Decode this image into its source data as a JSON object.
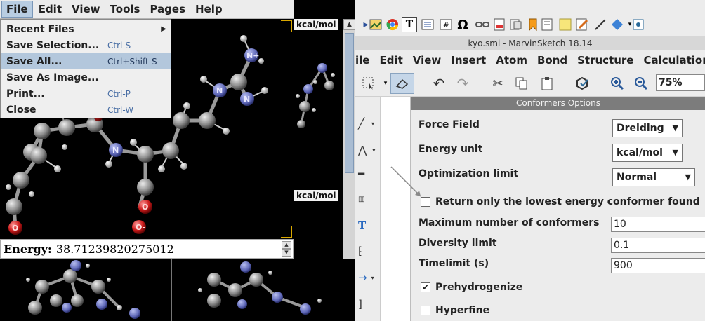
{
  "viewer": {
    "menus": [
      "File",
      "Edit",
      "View",
      "Tools",
      "Pages",
      "Help"
    ],
    "file_menu": {
      "items": [
        {
          "label": "Recent Files",
          "shortcut": ""
        },
        {
          "label": "Save Selection...",
          "shortcut": "Ctrl-S"
        },
        {
          "label": "Save All...",
          "shortcut": "Ctrl+Shift-S"
        },
        {
          "label": "Save As Image...",
          "shortcut": ""
        },
        {
          "label": "Print...",
          "shortcut": "Ctrl-P"
        },
        {
          "label": "Close",
          "shortcut": "Ctrl-W"
        }
      ],
      "submenu_arrow": "▶"
    },
    "unit_label_top": "kcal/mol",
    "unit_label_mid": "kcal/mol",
    "energy": {
      "label": "Energy:",
      "value": "38.71239820275012"
    },
    "scroll_up": "▲",
    "atoms": {
      "n": "N",
      "n_plus": "N+",
      "o": "O",
      "o_minus": "O-"
    }
  },
  "marvin": {
    "title": "kyo.smi - MarvinSketch 18.14",
    "menus": [
      "ile",
      "Edit",
      "View",
      "Insert",
      "Atom",
      "Bond",
      "Structure",
      "Calculations"
    ],
    "zoom": "75%",
    "omega": "Ω",
    "text_tool": "T"
  },
  "dialog": {
    "title": "Conformers Options",
    "force_field": {
      "label": "Force Field",
      "value": "Dreiding"
    },
    "energy_unit": {
      "label": "Energy unit",
      "value": "kcal/mol"
    },
    "optimization_limit": {
      "label": "Optimization limit",
      "value": "Normal"
    },
    "lowest_only": {
      "label": "Return only the lowest energy conformer found",
      "checked": false
    },
    "max_conformers": {
      "label": "Maximum number of conformers",
      "value": "10"
    },
    "diversity_limit": {
      "label": "Diversity limit",
      "value": "0.1"
    },
    "timelimit": {
      "label": "Timelimit (s)",
      "value": "900"
    },
    "prehydrogenize": {
      "label": "Prehydrogenize",
      "checked": true,
      "mark": "✔"
    },
    "hyperfine": {
      "label": "Hyperfine",
      "checked": false
    }
  },
  "colors": {
    "highlight": "#b3c7dc",
    "dialog_title_bg": "#7c7c7c",
    "nitrogen": "#6b74c8",
    "oxygen": "#d22020",
    "carbon": "#9a9a9a"
  }
}
